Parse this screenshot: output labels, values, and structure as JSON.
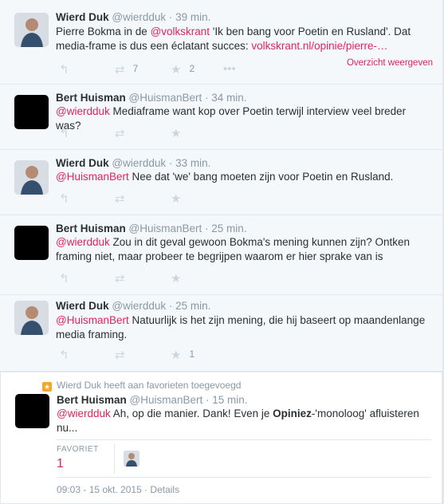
{
  "colors": {
    "accent": "#e0245e",
    "muted": "#8899a6",
    "text": "#292f33",
    "favorite_badge": "#f5a623"
  },
  "icons": [
    "reply-icon",
    "retweet-icon",
    "favorite-icon",
    "more-icon",
    "favorite-badge-icon"
  ],
  "tweets": [
    {
      "name": "Wierd Duk",
      "handle": "@wierdduk",
      "time": "· 39 min.",
      "text_a": "Pierre Bokma in de ",
      "mention": "@volkskrant",
      "text_b": " 'Ik ben bang voor Poetin en Rusland'. Dat media-frame is dus een éclatant succes: ",
      "url": "volkskrant.nl/opinie/pierre-…",
      "expand_label": "Overzicht weergeven",
      "retweets": "7",
      "favorites": "2"
    },
    {
      "name": "Bert Huisman",
      "handle": "@HuismanBert",
      "time": "· 34 min.",
      "mention": "@wierdduk",
      "text": " Mediaframe want kop over Poetin terwijl interview veel breder was?"
    },
    {
      "name": "Wierd Duk",
      "handle": "@wierdduk",
      "time": "· 33 min.",
      "mention": "@HuismanBert",
      "text": " Nee dat 'we' bang moeten zijn voor Poetin en Rusland."
    },
    {
      "name": "Bert Huisman",
      "handle": "@HuismanBert",
      "time": "· 25 min.",
      "mention": "@wierdduk",
      "text": " Zou in dit geval gewoon Bokma's mening kunnen zijn? Ontken framing niet, maar probeer te begrijpen waarom er hier sprake van is"
    },
    {
      "name": "Wierd Duk",
      "handle": "@wierdduk",
      "time": "· 25 min.",
      "mention": "@HuismanBert",
      "text": " Natuurlijk is het zijn mening, die hij baseert op maandenlange media framing.",
      "favorites": "1"
    },
    {
      "context": "Wierd Duk heeft aan favorieten toegevoegd",
      "name": "Bert Huisman",
      "handle": "@HuismanBert",
      "time": "· 15 min.",
      "mention": "@wierdduk",
      "text_a": " Ah, op die manier. Dank! Even je ",
      "text_bold": "Opiniez",
      "text_b": "-'monoloog' afluisteren nu...",
      "stats_label": "FAVORIET",
      "stats_value": "1",
      "datetime": "09:03 - 15 okt. 2015",
      "details_label": "Details"
    }
  ]
}
